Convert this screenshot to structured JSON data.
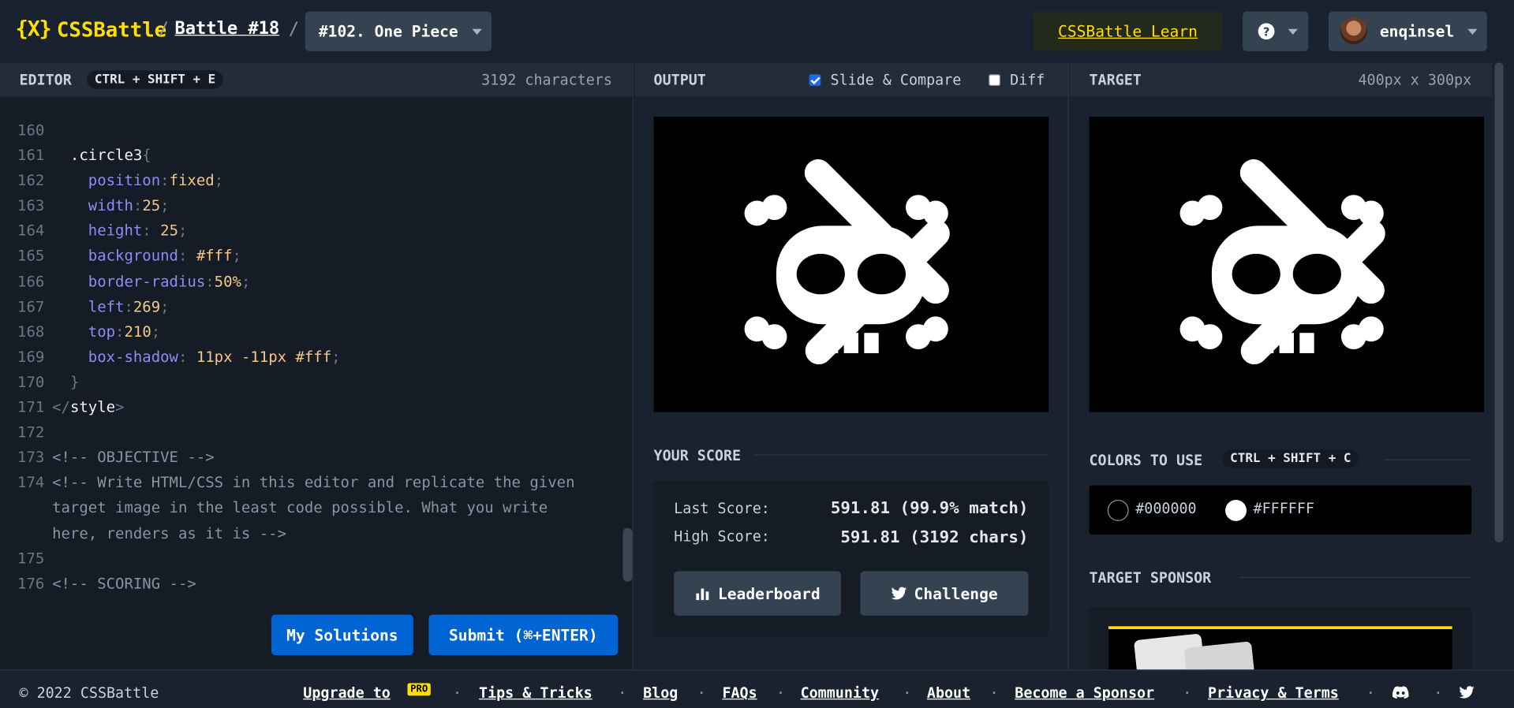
{
  "header": {
    "logo_mark": "{X}",
    "logo_text": "CSSBattle",
    "sep": "/",
    "battle_label": "Battle #18",
    "target_label": "#102. One Piece",
    "learn_label": "CSSBattle Learn",
    "help_glyph": "?",
    "username": "enqinsel"
  },
  "editor": {
    "title": "EDITOR",
    "shortcut": "CTRL + SHIFT + E",
    "char_count": "3192 characters",
    "lines": [
      {
        "n": "160",
        "parts": []
      },
      {
        "n": "161",
        "parts": [
          {
            "t": "  .circle3",
            "c": "sel"
          },
          {
            "t": "{",
            "c": "punc"
          }
        ]
      },
      {
        "n": "162",
        "parts": [
          {
            "t": "    position",
            "c": "prop"
          },
          {
            "t": ":",
            "c": "punc"
          },
          {
            "t": "fixed",
            "c": "val"
          },
          {
            "t": ";",
            "c": "punc"
          }
        ]
      },
      {
        "n": "163",
        "parts": [
          {
            "t": "    width",
            "c": "prop"
          },
          {
            "t": ":",
            "c": "punc"
          },
          {
            "t": "25",
            "c": "val"
          },
          {
            "t": ";",
            "c": "punc"
          }
        ]
      },
      {
        "n": "164",
        "parts": [
          {
            "t": "    height",
            "c": "prop"
          },
          {
            "t": ": ",
            "c": "punc"
          },
          {
            "t": "25",
            "c": "val"
          },
          {
            "t": ";",
            "c": "punc"
          }
        ]
      },
      {
        "n": "165",
        "parts": [
          {
            "t": "    background",
            "c": "prop"
          },
          {
            "t": ": ",
            "c": "punc"
          },
          {
            "t": "#fff",
            "c": "val"
          },
          {
            "t": ";",
            "c": "punc"
          }
        ]
      },
      {
        "n": "166",
        "parts": [
          {
            "t": "    border-radius",
            "c": "prop"
          },
          {
            "t": ":",
            "c": "punc"
          },
          {
            "t": "50%",
            "c": "val"
          },
          {
            "t": ";",
            "c": "punc"
          }
        ]
      },
      {
        "n": "167",
        "parts": [
          {
            "t": "    left",
            "c": "prop"
          },
          {
            "t": ":",
            "c": "punc"
          },
          {
            "t": "269",
            "c": "val"
          },
          {
            "t": ";",
            "c": "punc"
          }
        ]
      },
      {
        "n": "168",
        "parts": [
          {
            "t": "    top",
            "c": "prop"
          },
          {
            "t": ":",
            "c": "punc"
          },
          {
            "t": "210",
            "c": "val"
          },
          {
            "t": ";",
            "c": "punc"
          }
        ]
      },
      {
        "n": "169",
        "parts": [
          {
            "t": "    box-shadow",
            "c": "prop"
          },
          {
            "t": ": ",
            "c": "punc"
          },
          {
            "t": "11px -11px #fff",
            "c": "val"
          },
          {
            "t": ";",
            "c": "punc"
          }
        ]
      },
      {
        "n": "170",
        "parts": [
          {
            "t": "  }",
            "c": "punc"
          }
        ]
      },
      {
        "n": "171",
        "parts": [
          {
            "t": "</",
            "c": "punc"
          },
          {
            "t": "style",
            "c": "tagn"
          },
          {
            "t": ">",
            "c": "punc"
          }
        ]
      },
      {
        "n": "172",
        "parts": []
      },
      {
        "n": "173",
        "parts": [
          {
            "t": "<!-- OBJECTIVE -->",
            "c": "comment"
          }
        ]
      },
      {
        "n": "174",
        "parts": [
          {
            "t": "<!-- Write HTML/CSS in this editor and replicate the given",
            "c": "comment"
          }
        ]
      },
      {
        "n": "",
        "parts": [
          {
            "t": "target image in the least code possible. What you write",
            "c": "comment"
          }
        ]
      },
      {
        "n": "",
        "parts": [
          {
            "t": "here, renders as it is -->",
            "c": "comment"
          }
        ]
      },
      {
        "n": "175",
        "parts": []
      },
      {
        "n": "176",
        "parts": [
          {
            "t": "<!-- SCORING -->",
            "c": "comment"
          }
        ]
      }
    ],
    "my_solutions": "My Solutions",
    "submit": "Submit (⌘+ENTER)"
  },
  "output": {
    "title": "OUTPUT",
    "slide_compare": "Slide & Compare",
    "slide_compare_checked": true,
    "diff": "Diff",
    "diff_checked": false,
    "score_title": "YOUR SCORE",
    "last_label": "Last Score:",
    "last_value": "591.81 (99.9% match)",
    "high_label": "High Score:",
    "high_value": "591.81 (3192 chars)",
    "leaderboard": "Leaderboard",
    "challenge": "Challenge"
  },
  "target": {
    "title": "TARGET",
    "size": "400px x 300px",
    "colors_title": "COLORS TO USE",
    "colors_shortcut": "CTRL + SHIFT + C",
    "colors": [
      {
        "label": "#000000",
        "hex": "#000000"
      },
      {
        "label": "#FFFFFF",
        "hex": "#FFFFFF"
      }
    ],
    "sponsor_title": "TARGET SPONSOR"
  },
  "footer": {
    "copyright": "© 2022 CSSBattle",
    "upgrade": "Upgrade to",
    "pro": "PRO",
    "tips": "Tips & Tricks",
    "blog": "Blog",
    "faqs": "FAQs",
    "community": "Community",
    "about": "About",
    "sponsor": "Become a Sponsor",
    "privacy": "Privacy & Terms",
    "dot": "·"
  },
  "colors": {
    "accent": "#ffdf00",
    "primary_button": "#0064d3",
    "background": "#1a2230"
  }
}
